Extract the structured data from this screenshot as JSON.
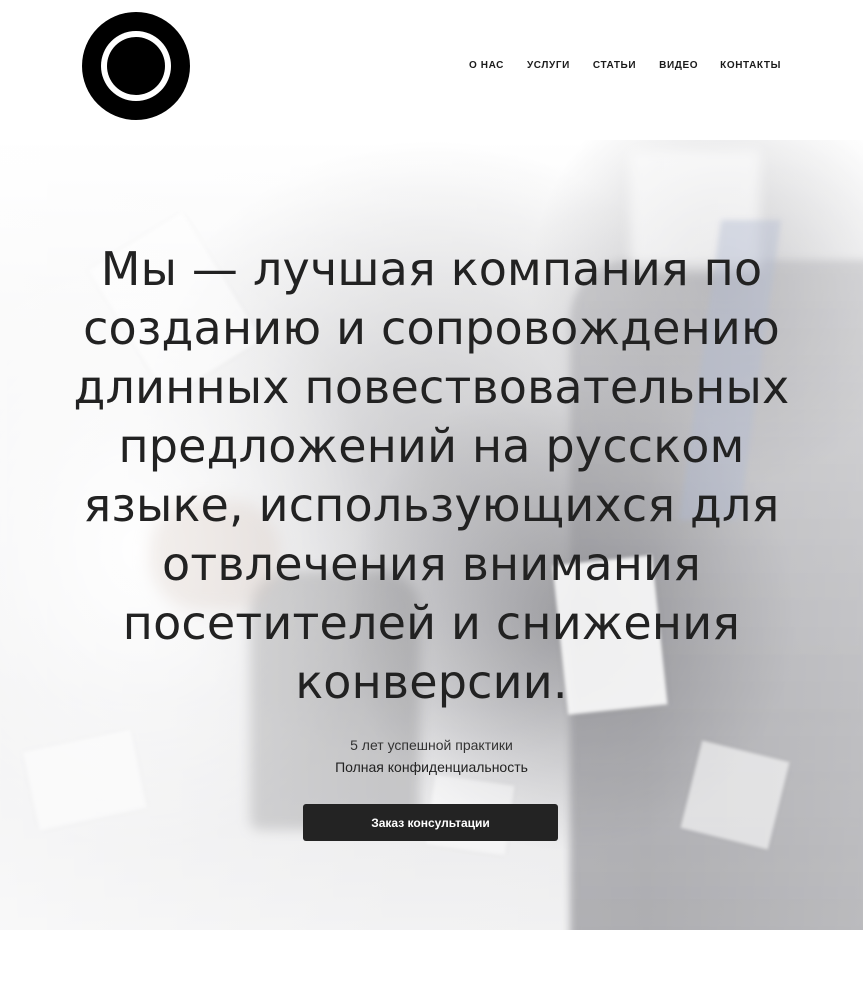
{
  "header": {
    "logo_icon": "ring-logo-icon",
    "nav": [
      {
        "label": "О НАС"
      },
      {
        "label": "УСЛУГИ"
      },
      {
        "label": "СТАТЬИ"
      },
      {
        "label": "ВИДЕО"
      },
      {
        "label": "КОНТАКТЫ"
      }
    ]
  },
  "hero": {
    "headline": "Мы — лучшая компания по созданию и сопровождению длинных повествовательных предложений на русском языке, использующихся для отвлечения внимания посетителей и снижения конверсии.",
    "subline_1": "5 лет успешной практики",
    "subline_2": "Полная конфиденциальность",
    "cta_label": "Заказ консультации"
  },
  "colors": {
    "text": "#222222",
    "cta_background": "#232323",
    "cta_text": "#ffffff",
    "page_background": "#ffffff"
  }
}
